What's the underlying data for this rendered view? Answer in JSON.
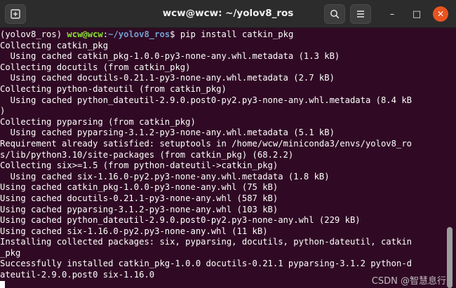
{
  "window": {
    "title": "wcw@wcw: ~/yolov8_ros",
    "new_tab_icon": "new-tab-icon",
    "search_icon": "search-icon",
    "menu_icon": "hamburger-menu-icon",
    "minimize_glyph": "–",
    "maximize_glyph": "□",
    "close_glyph": "✕",
    "accent_close": "#e95420"
  },
  "terminal": {
    "background": "#300a24",
    "prompt": {
      "env": "(yolov8_ros) ",
      "user": "wcw@wcw",
      "colon": ":",
      "path": "~/yolov8_ros",
      "dollar": "$ ",
      "command": "pip install catkin_pkg"
    },
    "lines": [
      "Collecting catkin_pkg",
      "  Using cached catkin_pkg-1.0.0-py3-none-any.whl.metadata (1.3 kB)",
      "Collecting docutils (from catkin_pkg)",
      "  Using cached docutils-0.21.1-py3-none-any.whl.metadata (2.7 kB)",
      "Collecting python-dateutil (from catkin_pkg)",
      "  Using cached python_dateutil-2.9.0.post0-py2.py3-none-any.whl.metadata (8.4 kB",
      ")",
      "Collecting pyparsing (from catkin_pkg)",
      "  Using cached pyparsing-3.1.2-py3-none-any.whl.metadata (5.1 kB)",
      "Requirement already satisfied: setuptools in /home/wcw/miniconda3/envs/yolov8_ro",
      "s/lib/python3.10/site-packages (from catkin_pkg) (68.2.2)",
      "Collecting six>=1.5 (from python-dateutil->catkin_pkg)",
      "  Using cached six-1.16.0-py2.py3-none-any.whl.metadata (1.8 kB)",
      "Using cached catkin_pkg-1.0.0-py3-none-any.whl (75 kB)",
      "Using cached docutils-0.21.1-py3-none-any.whl (587 kB)",
      "Using cached pyparsing-3.1.2-py3-none-any.whl (103 kB)",
      "Using cached python_dateutil-2.9.0.post0-py2.py3-none-any.whl (229 kB)",
      "Using cached six-1.16.0-py2.py3-none-any.whl (11 kB)",
      "Installing collected packages: six, pyparsing, docutils, python-dateutil, catkin",
      "_pkg",
      "Successfully installed catkin_pkg-1.0.0 docutils-0.21.1 pyparsing-3.1.2 python-d",
      "ateutil-2.9.0.post0 six-1.16.0"
    ]
  },
  "watermark": "CSDN @智慧息行"
}
